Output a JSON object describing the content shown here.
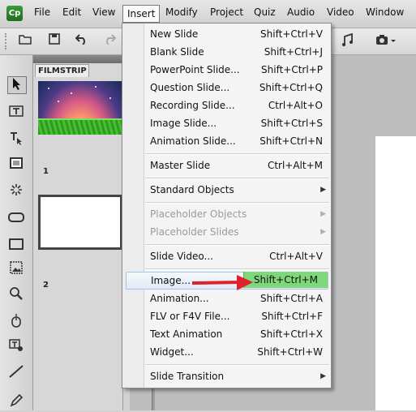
{
  "app": {
    "logo_text": "Cp"
  },
  "menubar": {
    "items": [
      {
        "label": "File"
      },
      {
        "label": "Edit"
      },
      {
        "label": "View"
      },
      {
        "label": "Insert"
      },
      {
        "label": "Modify"
      },
      {
        "label": "Project"
      },
      {
        "label": "Quiz"
      },
      {
        "label": "Audio"
      },
      {
        "label": "Video"
      },
      {
        "label": "Window"
      }
    ],
    "active_index": 3
  },
  "filmstrip": {
    "tab_label": "FILMSTRIP",
    "slides": [
      {
        "number": "1"
      },
      {
        "number": "2"
      }
    ]
  },
  "insert_menu": {
    "items": [
      {
        "label": "New Slide",
        "shortcut": "Shift+Ctrl+V"
      },
      {
        "label": "Blank Slide",
        "shortcut": "Shift+Ctrl+J"
      },
      {
        "label": "PowerPoint Slide...",
        "shortcut": "Shift+Ctrl+P"
      },
      {
        "label": "Question Slide...",
        "shortcut": "Shift+Ctrl+Q"
      },
      {
        "label": "Recording Slide...",
        "shortcut": "Ctrl+Alt+O"
      },
      {
        "label": "Image Slide...",
        "shortcut": "Shift+Ctrl+S"
      },
      {
        "label": "Animation Slide...",
        "shortcut": "Shift+Ctrl+N"
      },
      {
        "label": "Master Slide",
        "shortcut": "Ctrl+Alt+M"
      },
      {
        "label": "Standard Objects",
        "shortcut": ""
      },
      {
        "label": "Placeholder Objects",
        "shortcut": ""
      },
      {
        "label": "Placeholder Slides",
        "shortcut": ""
      },
      {
        "label": "Slide Video...",
        "shortcut": "Ctrl+Alt+V"
      },
      {
        "label": "Image...",
        "shortcut": "Shift+Ctrl+M"
      },
      {
        "label": "Animation...",
        "shortcut": "Shift+Ctrl+A"
      },
      {
        "label": "FLV or F4V File...",
        "shortcut": "Shift+Ctrl+F"
      },
      {
        "label": "Text Animation",
        "shortcut": "Shift+Ctrl+X"
      },
      {
        "label": "Widget...",
        "shortcut": "Shift+Ctrl+W"
      },
      {
        "label": "Slide Transition",
        "shortcut": ""
      }
    ],
    "highlighted_index": 12,
    "highlight_color": "#7ed87a",
    "annotation_arrow_color": "#e0202a"
  }
}
